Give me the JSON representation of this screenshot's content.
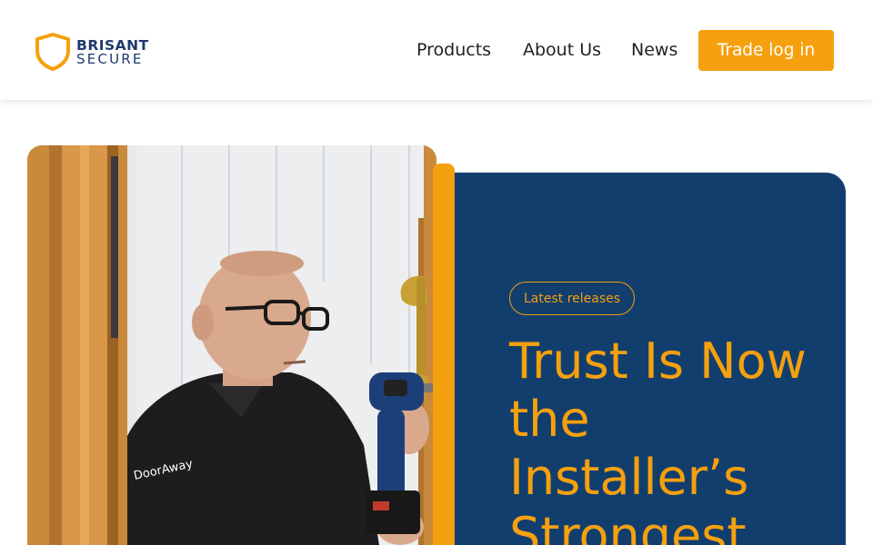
{
  "logo": {
    "word1": "BRISANT",
    "word2": "SECURE",
    "icon": "shield-icon"
  },
  "nav": {
    "products": "Products",
    "about": "About Us",
    "news": "News",
    "trade_login": "Trade log in"
  },
  "hero": {
    "badge": "Latest releases",
    "title": "Trust Is Now the Installer’s Strongest",
    "photo_shirt_logo": "DoorAway"
  },
  "colors": {
    "brand_navy": "#123e6e",
    "brand_orange": "#f5a00e",
    "logo_navy": "#1e3a6e"
  }
}
